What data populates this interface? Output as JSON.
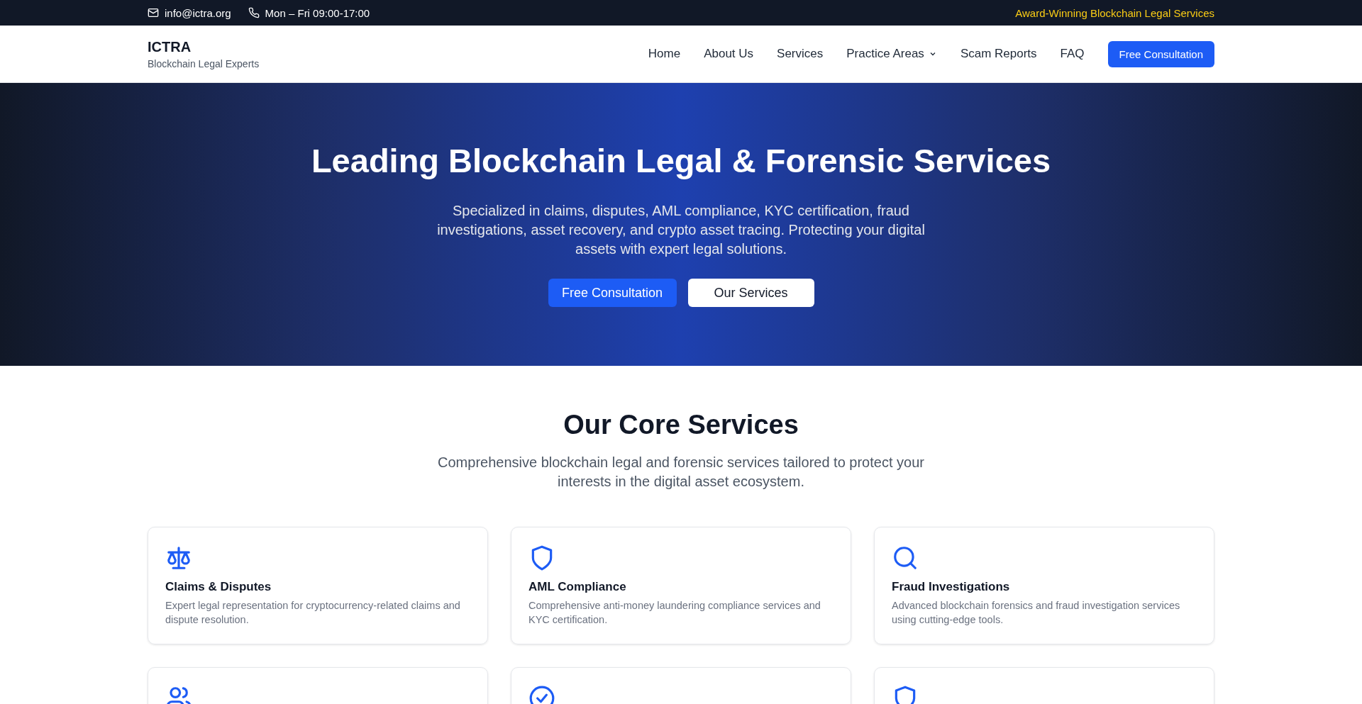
{
  "top_bar": {
    "email": "info@ictra.org",
    "hours": "Mon – Fri 09:00-17:00",
    "tagline": "Award-Winning Blockchain Legal Services"
  },
  "header": {
    "brand": "ICTRA",
    "brand_subtitle": "Blockchain Legal Experts",
    "nav": [
      {
        "label": "Home",
        "has_menu": false
      },
      {
        "label": "About Us",
        "has_menu": false
      },
      {
        "label": "Services",
        "has_menu": false
      },
      {
        "label": "Practice Areas",
        "has_menu": true
      },
      {
        "label": "Scam Reports",
        "has_menu": false
      },
      {
        "label": "FAQ",
        "has_menu": false
      }
    ],
    "cta": "Free Consultation"
  },
  "hero": {
    "title": "Leading Blockchain Legal & Forensic Services",
    "text": "Specialized in claims, disputes, AML compliance, KYC certification, fraud investigations, asset recovery, and crypto asset tracing. Protecting your digital assets with expert legal solutions.",
    "primary_button": "Free Consultation",
    "secondary_button": "Our Services"
  },
  "services": {
    "title": "Our Core Services",
    "subtitle": "Comprehensive blockchain legal and forensic services tailored to protect your interests in the digital asset ecosystem.",
    "cards": [
      {
        "kind": "full",
        "title": "Claims & Disputes",
        "description": "Expert legal representation for cryptocurrency-related claims and dispute resolution."
      },
      {
        "kind": "full",
        "title": "AML Compliance",
        "description": "Comprehensive anti-money laundering compliance services and KYC certification."
      },
      {
        "kind": "full",
        "title": "Fraud Investigations",
        "description": "Advanced blockchain forensics and fraud investigation services using cutting-edge tools."
      },
      {
        "kind": "cut"
      },
      {
        "kind": "cut"
      },
      {
        "kind": "cut"
      }
    ]
  }
}
